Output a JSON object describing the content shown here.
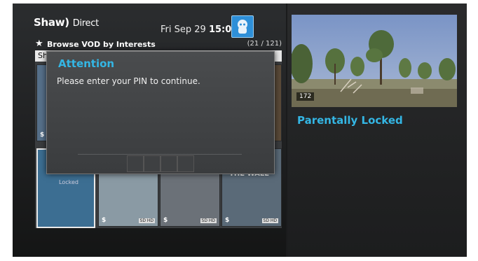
{
  "header": {
    "brand_name": "Shaw",
    "brand_paren": ")",
    "brand_sub": "Direct",
    "date": "Fri Sep 29",
    "time": "15:07"
  },
  "breadcrumb": {
    "title": "Browse VOD by Interests",
    "count": "(21 / 121)"
  },
  "filter": {
    "label": "Sh"
  },
  "tiles": {
    "locked_label": "Locked",
    "dollar": "$",
    "sd_hd": "SD HD",
    "wall_title": "THE WALL"
  },
  "dialog": {
    "title": "Attention",
    "message": "Please enter your PIN to continue.",
    "pin_slots": 4
  },
  "preview": {
    "channel_badge": "172",
    "status": "Parentally Locked"
  },
  "colors": {
    "accent": "#34b6e4",
    "background": "#1a1b1c"
  }
}
